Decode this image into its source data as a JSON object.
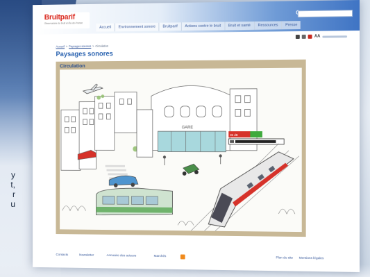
{
  "background": {
    "left_text_fragments": [
      "y",
      "t,",
      "r",
      "u"
    ]
  },
  "header": {
    "logo_word": "Bruitparif",
    "logo_tagline": "Observatoire du bruit en Île-de-France",
    "nav": [
      "Accueil",
      "Environnement sonore",
      "Bruitparif",
      "Actions contre le bruit",
      "Bruit et santé",
      "Ressources",
      "Presse"
    ],
    "tools_text_size_label": "AA"
  },
  "breadcrumb": {
    "items": [
      "Accueil",
      "Paysages sonores",
      "Circulation"
    ]
  },
  "main": {
    "page_title": "Paysages sonores",
    "scene_label": "Circulation",
    "station_sign": "GARE",
    "meter_min_label": "35 dB"
  },
  "footer": {
    "links_left": [
      "Contacts",
      "Newsletter",
      "Annuaire des acteurs",
      "Marchés"
    ],
    "links_right": [
      "Plan du site",
      "Mentions légales"
    ]
  },
  "colors": {
    "brand_red": "#d9261c",
    "brand_blue": "#2b63b0",
    "frame_tan": "#c8b896",
    "rss_orange": "#f08a1c"
  }
}
